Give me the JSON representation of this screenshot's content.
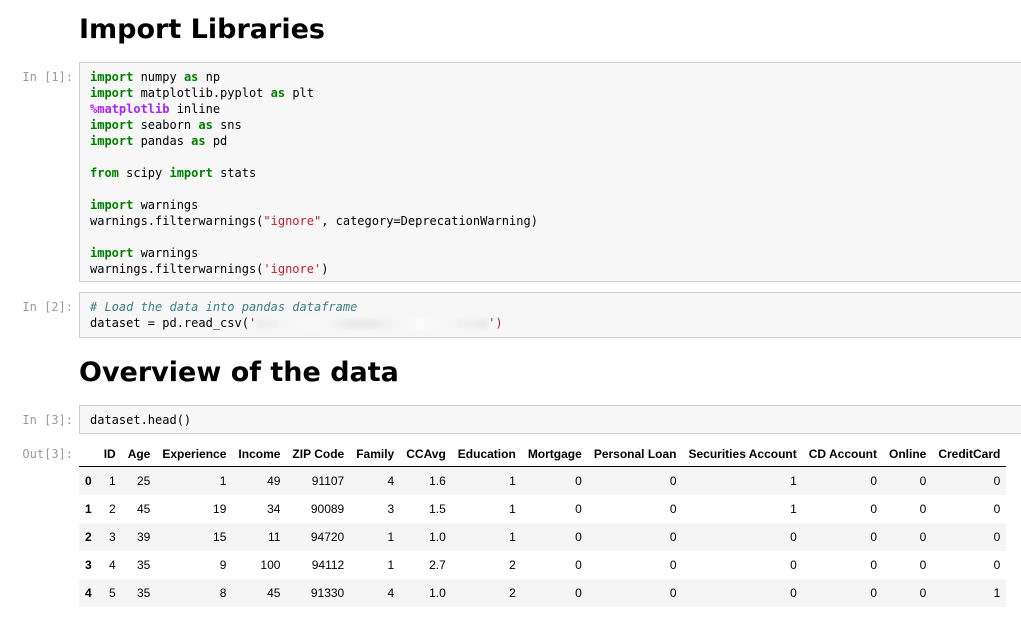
{
  "headings": {
    "import_libraries": "Import Libraries",
    "overview": "Overview of the data"
  },
  "cells": {
    "cell1": {
      "prompt": "In [1]:",
      "lines": [
        [
          [
            "kw",
            "import"
          ],
          [
            "t",
            " numpy "
          ],
          [
            "kw",
            "as"
          ],
          [
            "t",
            " np"
          ]
        ],
        [
          [
            "kw",
            "import"
          ],
          [
            "t",
            " matplotlib.pyplot "
          ],
          [
            "kw",
            "as"
          ],
          [
            "t",
            " plt"
          ]
        ],
        [
          [
            "magic",
            "%matplotlib"
          ],
          [
            "t",
            " inline"
          ]
        ],
        [
          [
            "kw",
            "import"
          ],
          [
            "t",
            " seaborn "
          ],
          [
            "kw",
            "as"
          ],
          [
            "t",
            " sns"
          ]
        ],
        [
          [
            "kw",
            "import"
          ],
          [
            "t",
            " pandas "
          ],
          [
            "kw",
            "as"
          ],
          [
            "t",
            " pd"
          ]
        ],
        [],
        [
          [
            "kw",
            "from"
          ],
          [
            "t",
            " scipy "
          ],
          [
            "kw",
            "import"
          ],
          [
            "t",
            " stats"
          ]
        ],
        [],
        [
          [
            "kw",
            "import"
          ],
          [
            "t",
            " warnings"
          ]
        ],
        [
          [
            "t",
            "warnings.filterwarnings("
          ],
          [
            "str",
            "\"ignore\""
          ],
          [
            "t",
            ", category=DeprecationWarning)"
          ]
        ],
        [],
        [
          [
            "kw",
            "import"
          ],
          [
            "t",
            " warnings"
          ]
        ],
        [
          [
            "t",
            "warnings.filterwarnings("
          ],
          [
            "str",
            "'ignore'"
          ],
          [
            "t",
            ")"
          ]
        ]
      ]
    },
    "cell2": {
      "prompt": "In [2]:",
      "lines": [
        [
          [
            "cmt",
            "# Load the data into pandas dataframe"
          ]
        ],
        [
          [
            "t",
            "dataset = pd.read_csv("
          ],
          [
            "str",
            "'"
          ],
          [
            "blur",
            ""
          ],
          [
            "str",
            "')"
          ]
        ]
      ]
    },
    "cell3": {
      "prompt": "In [3]:",
      "lines": [
        [
          [
            "t",
            "dataset.head()"
          ]
        ]
      ]
    },
    "output3": {
      "prompt": "Out[3]:"
    }
  },
  "dataframe": {
    "columns": [
      "ID",
      "Age",
      "Experience",
      "Income",
      "ZIP Code",
      "Family",
      "CCAvg",
      "Education",
      "Mortgage",
      "Personal Loan",
      "Securities Account",
      "CD Account",
      "Online",
      "CreditCard"
    ],
    "index": [
      "0",
      "1",
      "2",
      "3",
      "4"
    ],
    "rows": [
      [
        "1",
        "25",
        "1",
        "49",
        "91107",
        "4",
        "1.6",
        "1",
        "0",
        "0",
        "1",
        "0",
        "0",
        "0"
      ],
      [
        "2",
        "45",
        "19",
        "34",
        "90089",
        "3",
        "1.5",
        "1",
        "0",
        "0",
        "1",
        "0",
        "0",
        "0"
      ],
      [
        "3",
        "39",
        "15",
        "11",
        "94720",
        "1",
        "1.0",
        "1",
        "0",
        "0",
        "0",
        "0",
        "0",
        "0"
      ],
      [
        "4",
        "35",
        "9",
        "100",
        "94112",
        "1",
        "2.7",
        "2",
        "0",
        "0",
        "0",
        "0",
        "0",
        "0"
      ],
      [
        "5",
        "35",
        "8",
        "45",
        "91330",
        "4",
        "1.0",
        "2",
        "0",
        "0",
        "0",
        "0",
        "0",
        "1"
      ]
    ]
  }
}
